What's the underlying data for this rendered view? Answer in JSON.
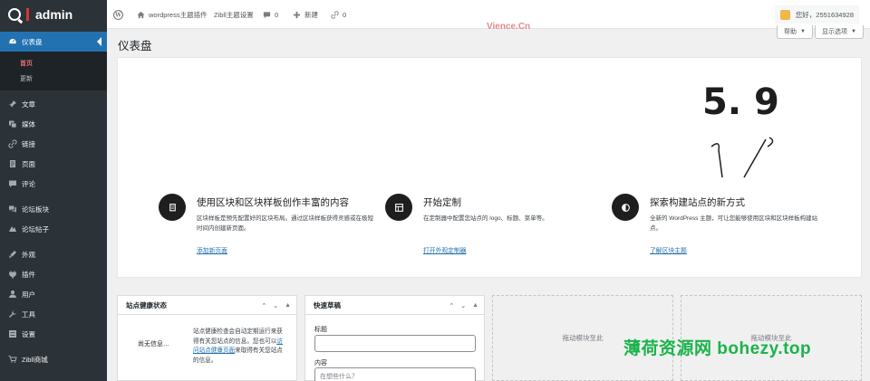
{
  "adminbar": {
    "logo_text": "admin",
    "wp_logo_icon": "wordpress-icon",
    "site_name": "wordpress主题插件",
    "theme_settings": "Zibll主题设置",
    "comments_count": "0",
    "new_label": "新建",
    "links_count": "0",
    "greeting": "您好，2551634928"
  },
  "sidebar": {
    "items": [
      {
        "label": "仪表盘",
        "icon": "dashboard-icon"
      },
      {
        "label": "文章",
        "icon": "pin-icon"
      },
      {
        "label": "媒体",
        "icon": "media-icon"
      },
      {
        "label": "链接",
        "icon": "link-icon"
      },
      {
        "label": "页面",
        "icon": "page-icon"
      },
      {
        "label": "评论",
        "icon": "comment-icon"
      },
      {
        "label": "论坛板块",
        "icon": "forum-icon"
      },
      {
        "label": "论坛帖子",
        "icon": "forum-post-icon"
      },
      {
        "label": "外观",
        "icon": "appearance-icon"
      },
      {
        "label": "插件",
        "icon": "plugin-icon"
      },
      {
        "label": "用户",
        "icon": "user-icon"
      },
      {
        "label": "工具",
        "icon": "tools-icon"
      },
      {
        "label": "设置",
        "icon": "settings-icon"
      },
      {
        "label": "Zibll商城",
        "icon": "shop-icon"
      }
    ],
    "submenu": [
      "首页",
      "更新"
    ]
  },
  "header": {
    "title": "仪表盘",
    "help": "帮助",
    "screen_options": "显示选项",
    "watermark": "Vience.Cn"
  },
  "welcome": {
    "version_text": "5. 9",
    "columns": [
      {
        "title": "使用区块和区块样板创作丰富的内容",
        "desc": "区块样板是预先配置好的区块布局。通过区块样板获得灵感或在极短时间内创建新页面。",
        "link": "添加新页面",
        "icon": "document-icon"
      },
      {
        "title": "开始定制",
        "desc": "在定制器中配置您站点的 logo、标题、菜单等。",
        "link": "打开外观定制器",
        "icon": "layout-icon"
      },
      {
        "title": "探索构建站点的新方式",
        "desc": "全新的 WordPress 主题，可让您能够使用区块和区块样板构建站点。",
        "link": "了解区块主题",
        "icon": "halfcircle-icon"
      }
    ]
  },
  "site_health": {
    "title": "站点健康状态",
    "no_info": "尚无信息…",
    "desc": "站点健康检查会自动定期运行来获得有关您站点的信息。您也可以",
    "link": "访问站点健康页面",
    "desc_after": "来取得有关您站点的信息。"
  },
  "quick_draft": {
    "title": "快速草稿",
    "title_label": "标题",
    "content_label": "内容",
    "content_placeholder": "在想些什么？"
  },
  "dropzones": [
    "拖动模块至此",
    "拖动模块至此"
  ],
  "bottom_watermark": "薄荷资源网 bohezy.top"
}
